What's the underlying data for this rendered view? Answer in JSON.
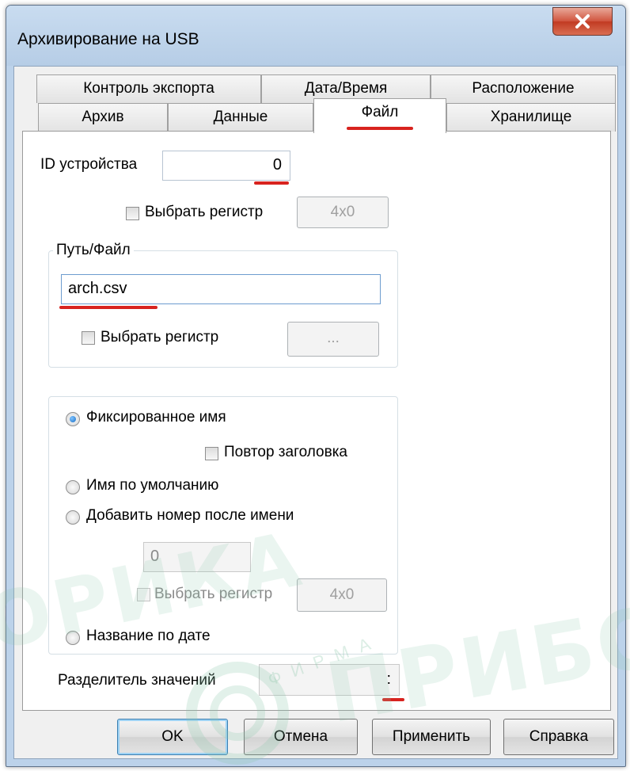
{
  "window": {
    "title": "Архивирование на USB"
  },
  "tabs_row1": [
    "Контроль экспорта",
    "Дата/Время",
    "Расположение"
  ],
  "tabs_row2": [
    "Архив",
    "Данные",
    "Файл",
    "Хранилище"
  ],
  "active_tab": "Файл",
  "device": {
    "label": "ID устройства",
    "value": "0",
    "select_register_label": "Выбрать регистр",
    "register_button": "4x0"
  },
  "path_group": {
    "legend": "Путь/Файл",
    "value": "arch.csv",
    "select_register_label": "Выбрать регистр",
    "browse_button": "..."
  },
  "naming": {
    "fixed_name": "Фиксированное имя",
    "repeat_header": "Повтор заголовка",
    "default_name": "Имя по умолчанию",
    "add_number": "Добавить номер после имени",
    "number_value": "0",
    "select_register_label": "Выбрать регистр",
    "register_button": "4x0",
    "date_name": "Название по дате",
    "selected": "fixed_name"
  },
  "separator": {
    "label": "Разделитель значений",
    "value": ":"
  },
  "buttons": {
    "ok": "OK",
    "cancel": "Отмена",
    "apply": "Применить",
    "help": "Справка"
  },
  "watermark": {
    "main": "ПРИБОР",
    "arc": "ФИРМА"
  },
  "colors": {
    "highlight": "#d8231f",
    "titlebar": "#bcd2ea"
  }
}
